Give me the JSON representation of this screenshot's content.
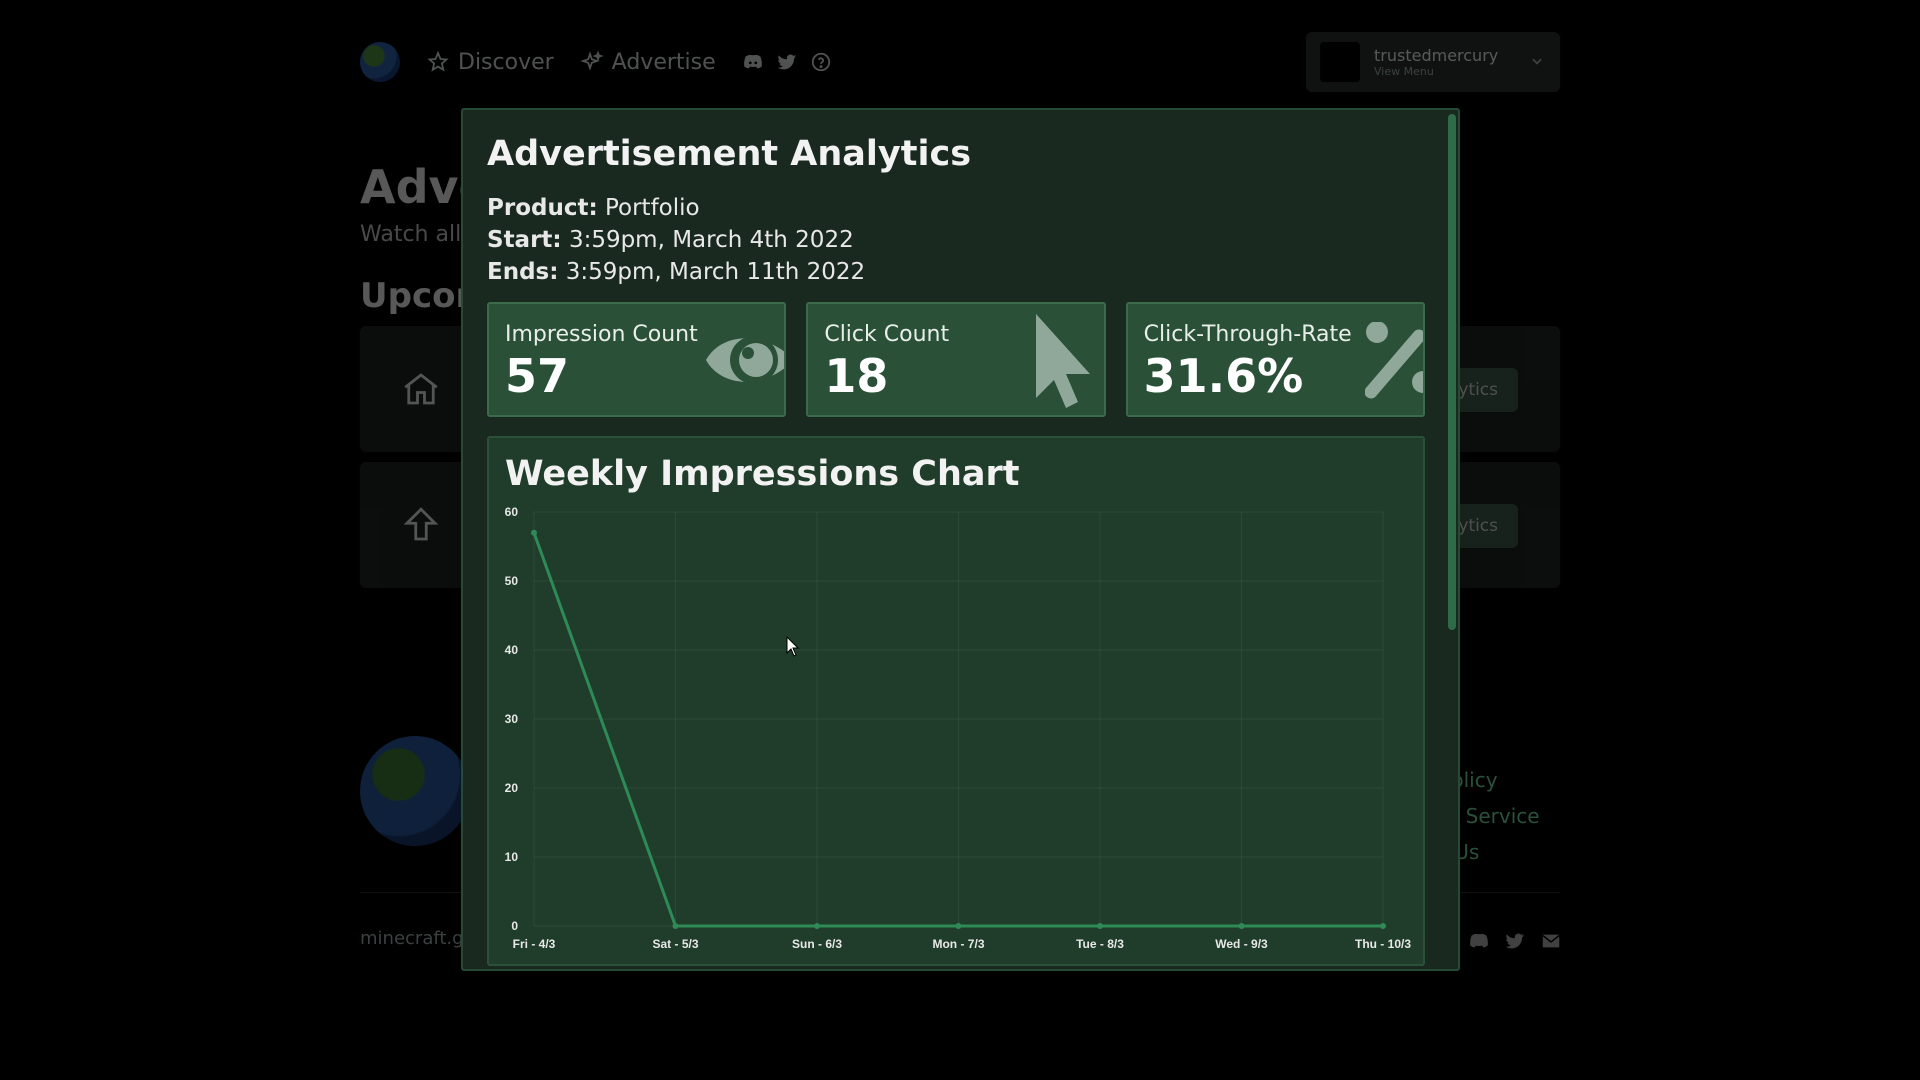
{
  "nav": {
    "discover": "Discover",
    "advertise": "Advertise"
  },
  "user": {
    "name": "trustedmercury",
    "sub": "View Menu"
  },
  "background": {
    "title": "Adve",
    "subtitle": "Watch all",
    "upcoming": "Upcon",
    "card_button": "ytics",
    "links": [
      "Policy",
      "of Service",
      "t Us"
    ],
    "footer": "minecraft.gl"
  },
  "modal": {
    "title": "Advertisement Analytics",
    "product_label": "Product:",
    "product_value": "Portfolio",
    "start_label": "Start:",
    "start_value": "3:59pm, March 4th 2022",
    "ends_label": "Ends:",
    "ends_value": "3:59pm, March 11th 2022",
    "stats": [
      {
        "label": "Impression Count",
        "value": "57",
        "icon": "eye-icon"
      },
      {
        "label": "Click Count",
        "value": "18",
        "icon": "pointer-icon"
      },
      {
        "label": "Click-Through-Rate",
        "value": "31.6%",
        "icon": "percent-icon"
      }
    ],
    "chart_title": "Weekly Impressions Chart"
  },
  "colors": {
    "accent": "#2e8b57",
    "modal_bg": "#19291f",
    "card_bg": "#2a5138",
    "line": "#2e8b57"
  },
  "chart_data": {
    "type": "line",
    "title": "Weekly Impressions Chart",
    "categories": [
      "Fri - 4/3",
      "Sat - 5/3",
      "Sun - 6/3",
      "Mon - 7/3",
      "Tue - 8/3",
      "Wed - 9/3",
      "Thu - 10/3"
    ],
    "series": [
      {
        "values": [
          57,
          0,
          0,
          0,
          0,
          0,
          0
        ]
      }
    ],
    "ylim": [
      0,
      60
    ],
    "yticks": [
      0,
      10,
      20,
      30,
      40,
      50,
      60
    ],
    "grid": true
  }
}
